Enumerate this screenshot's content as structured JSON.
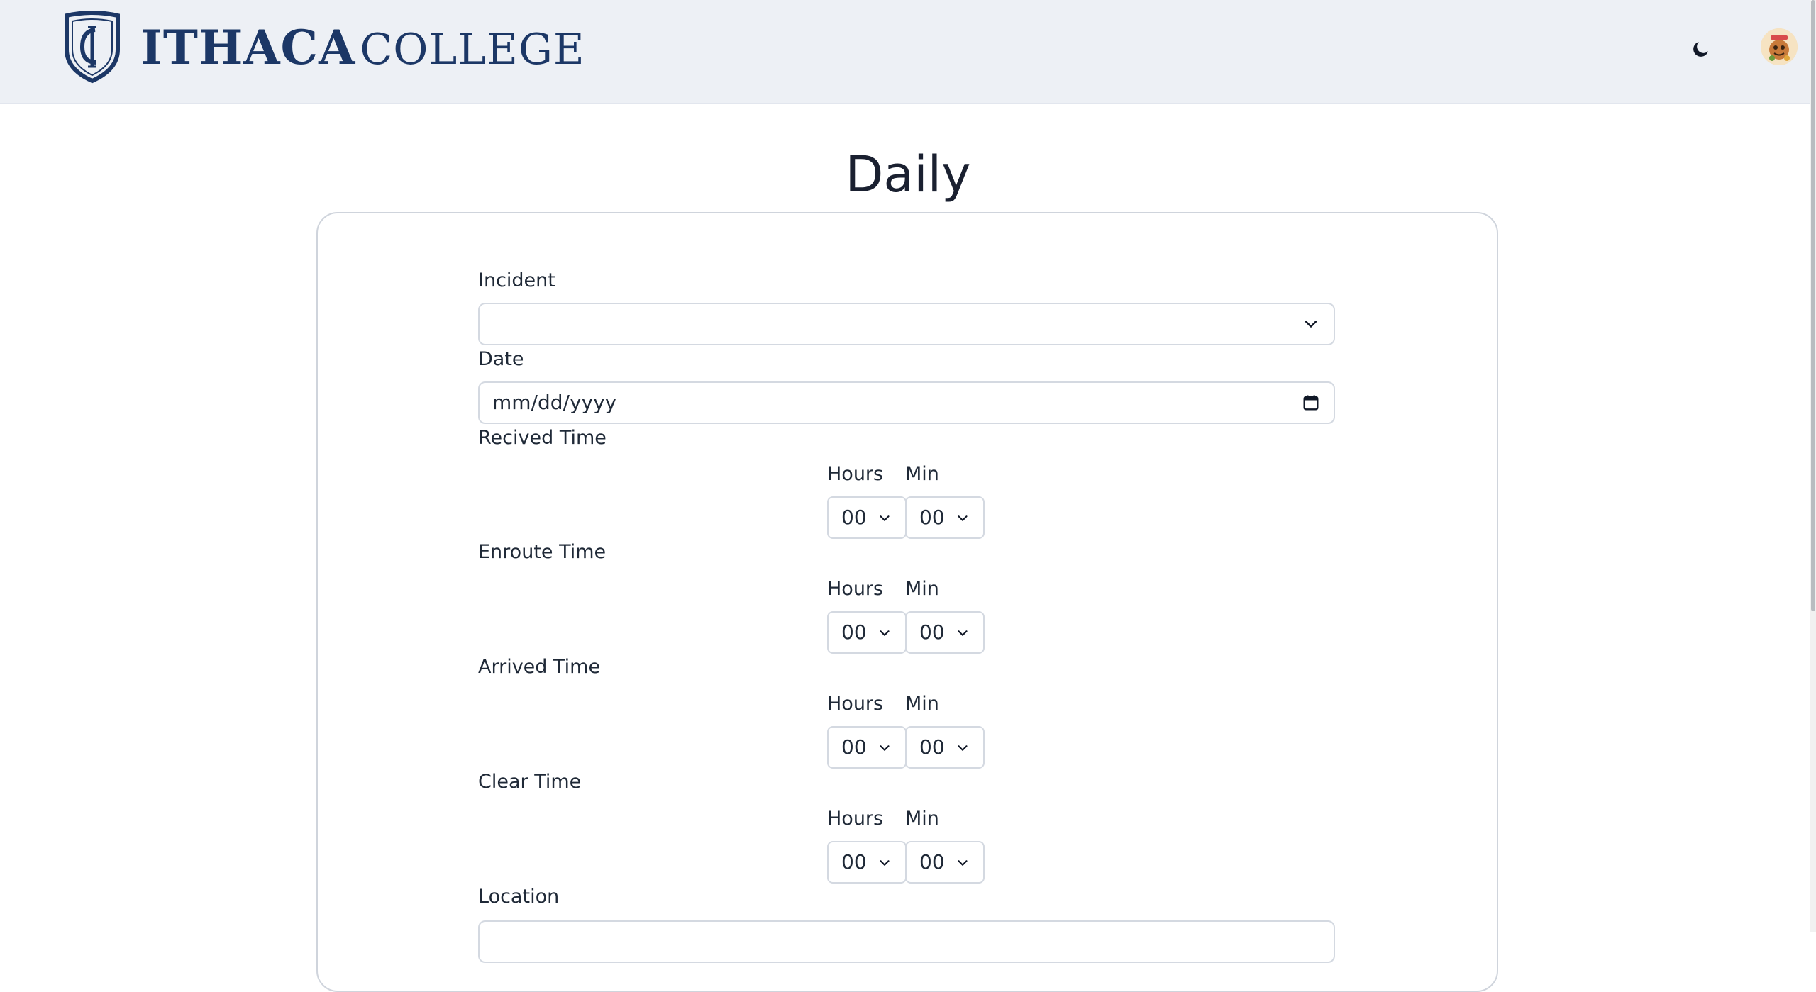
{
  "header": {
    "logo_text_main": "ITHACA",
    "logo_text_secondary": "COLLEGE",
    "theme_toggle_icon": "moon-icon",
    "avatar_icon": "user-avatar"
  },
  "page": {
    "title": "Daily"
  },
  "form": {
    "incident": {
      "label": "Incident",
      "value": ""
    },
    "date": {
      "label": "Date",
      "placeholder": "mm/dd/yyyy"
    },
    "times": [
      {
        "label": "Recived Time",
        "hours_label": "Hours",
        "min_label": "Min",
        "hours": "00",
        "min": "00"
      },
      {
        "label": "Enroute Time",
        "hours_label": "Hours",
        "min_label": "Min",
        "hours": "00",
        "min": "00"
      },
      {
        "label": "Arrived Time",
        "hours_label": "Hours",
        "min_label": "Min",
        "hours": "00",
        "min": "00"
      },
      {
        "label": "Clear Time",
        "hours_label": "Hours",
        "min_label": "Min",
        "hours": "00",
        "min": "00"
      }
    ],
    "location": {
      "label": "Location",
      "value": ""
    }
  },
  "colors": {
    "header_bg": "#edf0f5",
    "brand_navy": "#1c3766",
    "border": "#d4d9e1"
  }
}
